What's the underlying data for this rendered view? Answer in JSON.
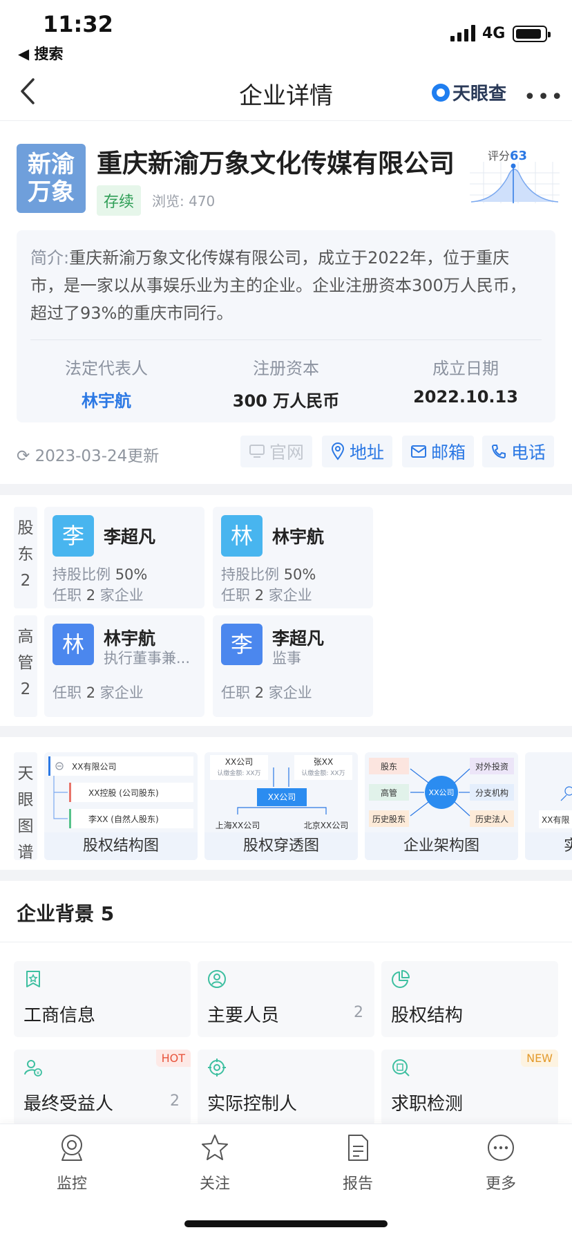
{
  "status_bar": {
    "time": "11:32",
    "back_app": "◀ 搜索",
    "network": "4G"
  },
  "nav": {
    "title": "企业详情",
    "brand": "天眼查"
  },
  "company": {
    "logo_text_line1": "新渝",
    "logo_text_line2": "万象",
    "name": "重庆新渝万象文化传媒有限公司",
    "status": "存续",
    "views": "浏览: 470",
    "score_label": "评分",
    "score_value": "63",
    "intro_key": "简介:",
    "intro_text": "重庆新渝万象文化传媒有限公司，成立于2022年，位于重庆市，是一家以从事娱乐业为主的企业。企业注册资本300万人民币，超过了93%的重庆市同行。",
    "facts": [
      {
        "label": "法定代表人",
        "value": "林宇航"
      },
      {
        "label": "注册资本",
        "value": "300 万人民币"
      },
      {
        "label": "成立日期",
        "value": "2022.10.13"
      }
    ]
  },
  "actions": {
    "updated": "2023-03-24更新",
    "website": "官网",
    "address": "地址",
    "email": "邮箱",
    "phone": "电话"
  },
  "shareholders": {
    "label": "股东2",
    "items": [
      {
        "avatar": "李",
        "name": "李超凡",
        "ratio_label": "持股比例",
        "ratio": "50%",
        "jobs_pre": "任职",
        "jobs": "2",
        "jobs_post": "家企业"
      },
      {
        "avatar": "林",
        "name": "林宇航",
        "ratio_label": "持股比例",
        "ratio": "50%",
        "jobs_pre": "任职",
        "jobs": "2",
        "jobs_post": "家企业"
      }
    ]
  },
  "executives": {
    "label": "高管2",
    "items": [
      {
        "avatar": "林",
        "name": "林宇航",
        "role": "执行董事兼...",
        "jobs_pre": "任职",
        "jobs": "2",
        "jobs_post": "家企业"
      },
      {
        "avatar": "李",
        "name": "李超凡",
        "role": "监事",
        "jobs_pre": "任职",
        "jobs": "2",
        "jobs_post": "家企业"
      }
    ]
  },
  "atlas": {
    "label": "天眼图谱",
    "cards": [
      {
        "title": "股权结构图",
        "n1": "XX有限公司",
        "n2": "XX控股 (公司股东)",
        "n3": "李XX (自然人股东)"
      },
      {
        "title": "股权穿透图",
        "a": "XX公司",
        "a_sub": "认缴金额: XX万",
        "b": "张XX",
        "b_sub": "认缴金额: XX万",
        "center": "XX公司",
        "c": "上海XX公司",
        "d": "北京XX公司"
      },
      {
        "title": "企业架构图",
        "l1": "股东",
        "l2": "高管",
        "l3": "历史股东",
        "center": "XX公司",
        "r1": "对外投资",
        "r2": "分支机构",
        "r3": "历史法人"
      },
      {
        "title": "实",
        "n1": "XX有限"
      }
    ]
  },
  "background": {
    "title": "企业背景 5",
    "items": [
      {
        "title": "工商信息",
        "count": "",
        "badge": "",
        "icon": "star-doc-icon"
      },
      {
        "title": "主要人员",
        "count": "2",
        "badge": "",
        "icon": "person-circle-icon"
      },
      {
        "title": "股权结构",
        "count": "",
        "badge": "",
        "icon": "pie-icon"
      },
      {
        "title": "最终受益人",
        "count": "2",
        "badge": "HOT",
        "icon": "beneficiary-icon"
      },
      {
        "title": "实际控制人",
        "count": "",
        "badge": "",
        "icon": "target-icon"
      },
      {
        "title": "求职检测",
        "count": "",
        "badge": "NEW",
        "icon": "building-search-icon"
      }
    ]
  },
  "tabbar": {
    "items": [
      "监控",
      "关注",
      "报告",
      "更多"
    ]
  },
  "colors": {
    "accent": "#2b78e4",
    "green": "#2f9e56",
    "bg_card": "#f5f7fb"
  }
}
